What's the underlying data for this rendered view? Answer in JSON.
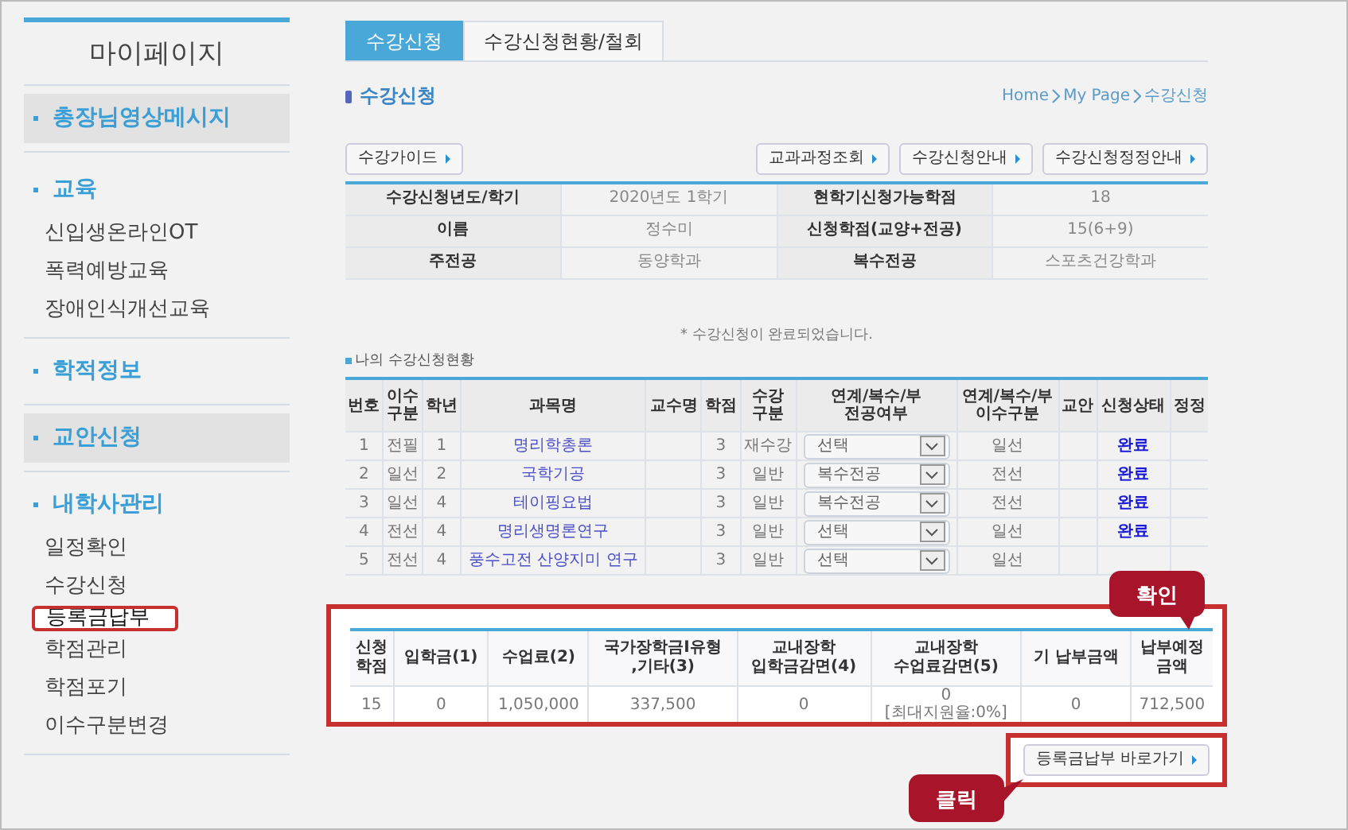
{
  "sidebar": {
    "title": "마이페이지",
    "sections": [
      {
        "label": "총장님영상메시지",
        "shaded": true
      },
      {
        "label": "교육",
        "shaded": false,
        "children": [
          {
            "label": "신입생온라인OT",
            "selected": false
          },
          {
            "label": "폭력예방교육",
            "selected": false
          },
          {
            "label": "장애인식개선교육",
            "selected": false
          }
        ]
      },
      {
        "label": "학적정보",
        "shaded": false
      },
      {
        "label": "교안신청",
        "shaded": true
      },
      {
        "label": "내학사관리",
        "shaded": false,
        "children": [
          {
            "label": "일정확인",
            "selected": false
          },
          {
            "label": "수강신청",
            "selected": false
          },
          {
            "label": "등록금납부",
            "selected": true
          },
          {
            "label": "학점관리",
            "selected": false
          },
          {
            "label": "학점포기",
            "selected": false
          },
          {
            "label": "이수구분변경",
            "selected": false
          }
        ]
      }
    ]
  },
  "tabs": [
    {
      "label": "수강신청",
      "selected": true
    },
    {
      "label": "수강신청현황/철회",
      "selected": false
    }
  ],
  "page_title": "수강신청",
  "breadcrumb": [
    "Home",
    "My Page",
    "수강신청"
  ],
  "left_buttons": [
    "수강가이드"
  ],
  "right_buttons": [
    "교과과정조회",
    "수강신청안내",
    "수강신청정정안내"
  ],
  "info_rows": [
    [
      "수강신청년도/학기",
      "2020년도 1학기",
      "현학기신청가능학점",
      "18"
    ],
    [
      "이름",
      "정수미",
      "신청학점(교양+전공)",
      "15(6+9)"
    ],
    [
      "주전공",
      "동양학과",
      "복수전공",
      "스포츠건강학과"
    ]
  ],
  "notice": "* 수강신청이 완료되었습니다.",
  "courses_heading": "나의 수강신청현황",
  "course_columns": [
    "번호",
    "이수\n구분",
    "학년",
    "과목명",
    "교수명",
    "학점",
    "수강\n구분",
    "연계/복수/부\n전공여부",
    "연계/복수/부\n이수구분",
    "교안",
    "신청상태",
    "정정"
  ],
  "courses": [
    {
      "no": "1",
      "type": "전필",
      "year": "1",
      "name": "명리학총론",
      "credit": "3",
      "kind": "재수강",
      "major": "선택",
      "category": "일선",
      "status": "완료"
    },
    {
      "no": "2",
      "type": "일선",
      "year": "2",
      "name": "국학기공",
      "credit": "3",
      "kind": "일반",
      "major": "복수전공",
      "category": "전선",
      "status": "완료"
    },
    {
      "no": "3",
      "type": "일선",
      "year": "4",
      "name": "테이핑요법",
      "credit": "3",
      "kind": "일반",
      "major": "복수전공",
      "category": "전선",
      "status": "완료"
    },
    {
      "no": "4",
      "type": "전선",
      "year": "4",
      "name": "명리생명론연구",
      "credit": "3",
      "kind": "일반",
      "major": "선택",
      "category": "일선",
      "status": "완료"
    },
    {
      "no": "5",
      "type": "전선",
      "year": "4",
      "name": "풍수고전 산양지미 연구",
      "credit": "3",
      "kind": "일반",
      "major": "선택",
      "category": "일선"
    }
  ],
  "summary": {
    "highlighted": true,
    "columns": [
      "신청\n학점",
      "입학금(1)",
      "수업료(2)",
      "국가장학금I유형\n,기타(3)",
      "교내장학\n입학금감면(4)",
      "교내장학\n수업료감면(5)",
      "기 납부금액",
      "납부예정\n금액"
    ],
    "row": [
      "15",
      "0",
      "1,050,000",
      "337,500",
      "0",
      "0\n[최대지원율:0%]",
      "0",
      "712,500"
    ]
  },
  "shortcut_button": {
    "label": "등록금납부 바로가기",
    "highlighted": true
  },
  "callouts": [
    {
      "kind": "down",
      "text": "확인"
    },
    {
      "kind": "right",
      "text": "클릭"
    }
  ]
}
